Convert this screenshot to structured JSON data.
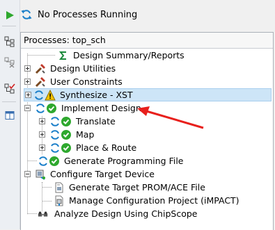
{
  "status": {
    "text": "No Processes Running"
  },
  "panel": {
    "header": "Processes: top_sch"
  },
  "tree": [
    {
      "label": "Design Summary/Reports",
      "icon": "sigma-icon"
    },
    {
      "label": "Design Utilities",
      "icon": "tools-icon"
    },
    {
      "label": "User Constraints",
      "icon": "tools-icon"
    },
    {
      "label": "Synthesize - XST",
      "icon": "warning-icon"
    },
    {
      "label": "Implement Design",
      "icon": "check-icon"
    },
    {
      "label": "Translate",
      "icon": "check-icon"
    },
    {
      "label": "Map",
      "icon": "check-icon"
    },
    {
      "label": "Place & Route",
      "icon": "check-icon"
    },
    {
      "label": "Generate Programming File",
      "icon": "check-icon"
    },
    {
      "label": "Configure Target Device",
      "icon": "target-device-icon"
    },
    {
      "label": "Generate Target PROM/ACE File",
      "icon": "prom-file-icon"
    },
    {
      "label": "Manage Configuration Project (iMPACT)",
      "icon": "impact-icon"
    },
    {
      "label": "Analyze Design Using ChipScope",
      "icon": "chipscope-icon"
    }
  ],
  "colors": {
    "accent": "#1a7fc9",
    "success": "#2ea82e",
    "warning": "#f2c200",
    "selection": "#cde5f7",
    "annotation_arrow": "#e8201c"
  }
}
